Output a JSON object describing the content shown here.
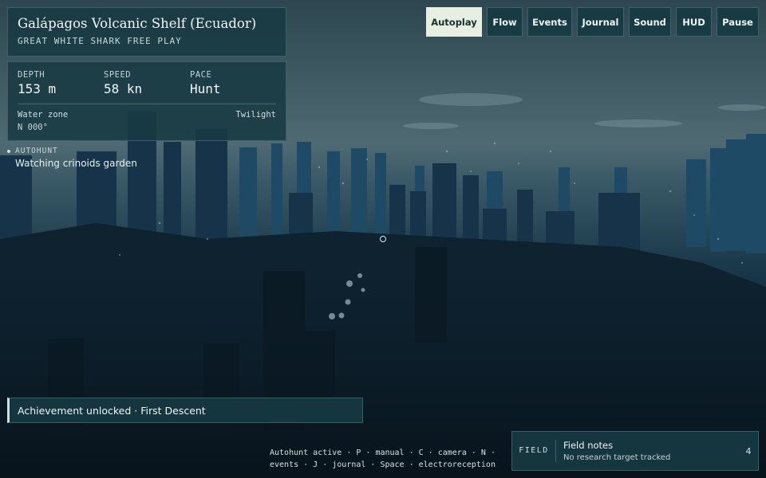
{
  "location": {
    "title": "Galápagos Volcanic Shelf (Ecuador)",
    "subtitle": "GREAT WHITE SHARK FREE PLAY"
  },
  "stats": {
    "depth_label": "DEPTH",
    "depth_value": "153 m",
    "speed_label": "SPEED",
    "speed_value": "58 kn",
    "pace_label": "PACE",
    "pace_value": "Hunt",
    "zone_label": "Water zone",
    "zone_value": "Twilight",
    "heading": "N 000°"
  },
  "autohunt": {
    "tag": "AUTOHUNT",
    "message": "Watching crinoids garden"
  },
  "toolbar": {
    "autoplay": "Autoplay",
    "flow": "Flow",
    "events": "Events",
    "journal": "Journal",
    "sound": "Sound",
    "hud": "HUD",
    "pause": "Pause"
  },
  "achievement": "Achievement unlocked · First Descent",
  "hints": {
    "line1": "Autohunt active · P · manual · C · camera · N ·",
    "line2": "events · J · journal · Space · electroreception"
  },
  "field": {
    "tag": "FIELD",
    "title": "Field notes",
    "subtitle": "No research target tracked",
    "count": "4"
  },
  "colors": {
    "panel_bg": "#183a42",
    "active_button": "#e7eee2",
    "water_top": "#2e4a55",
    "water_bottom": "#0b1a22"
  }
}
